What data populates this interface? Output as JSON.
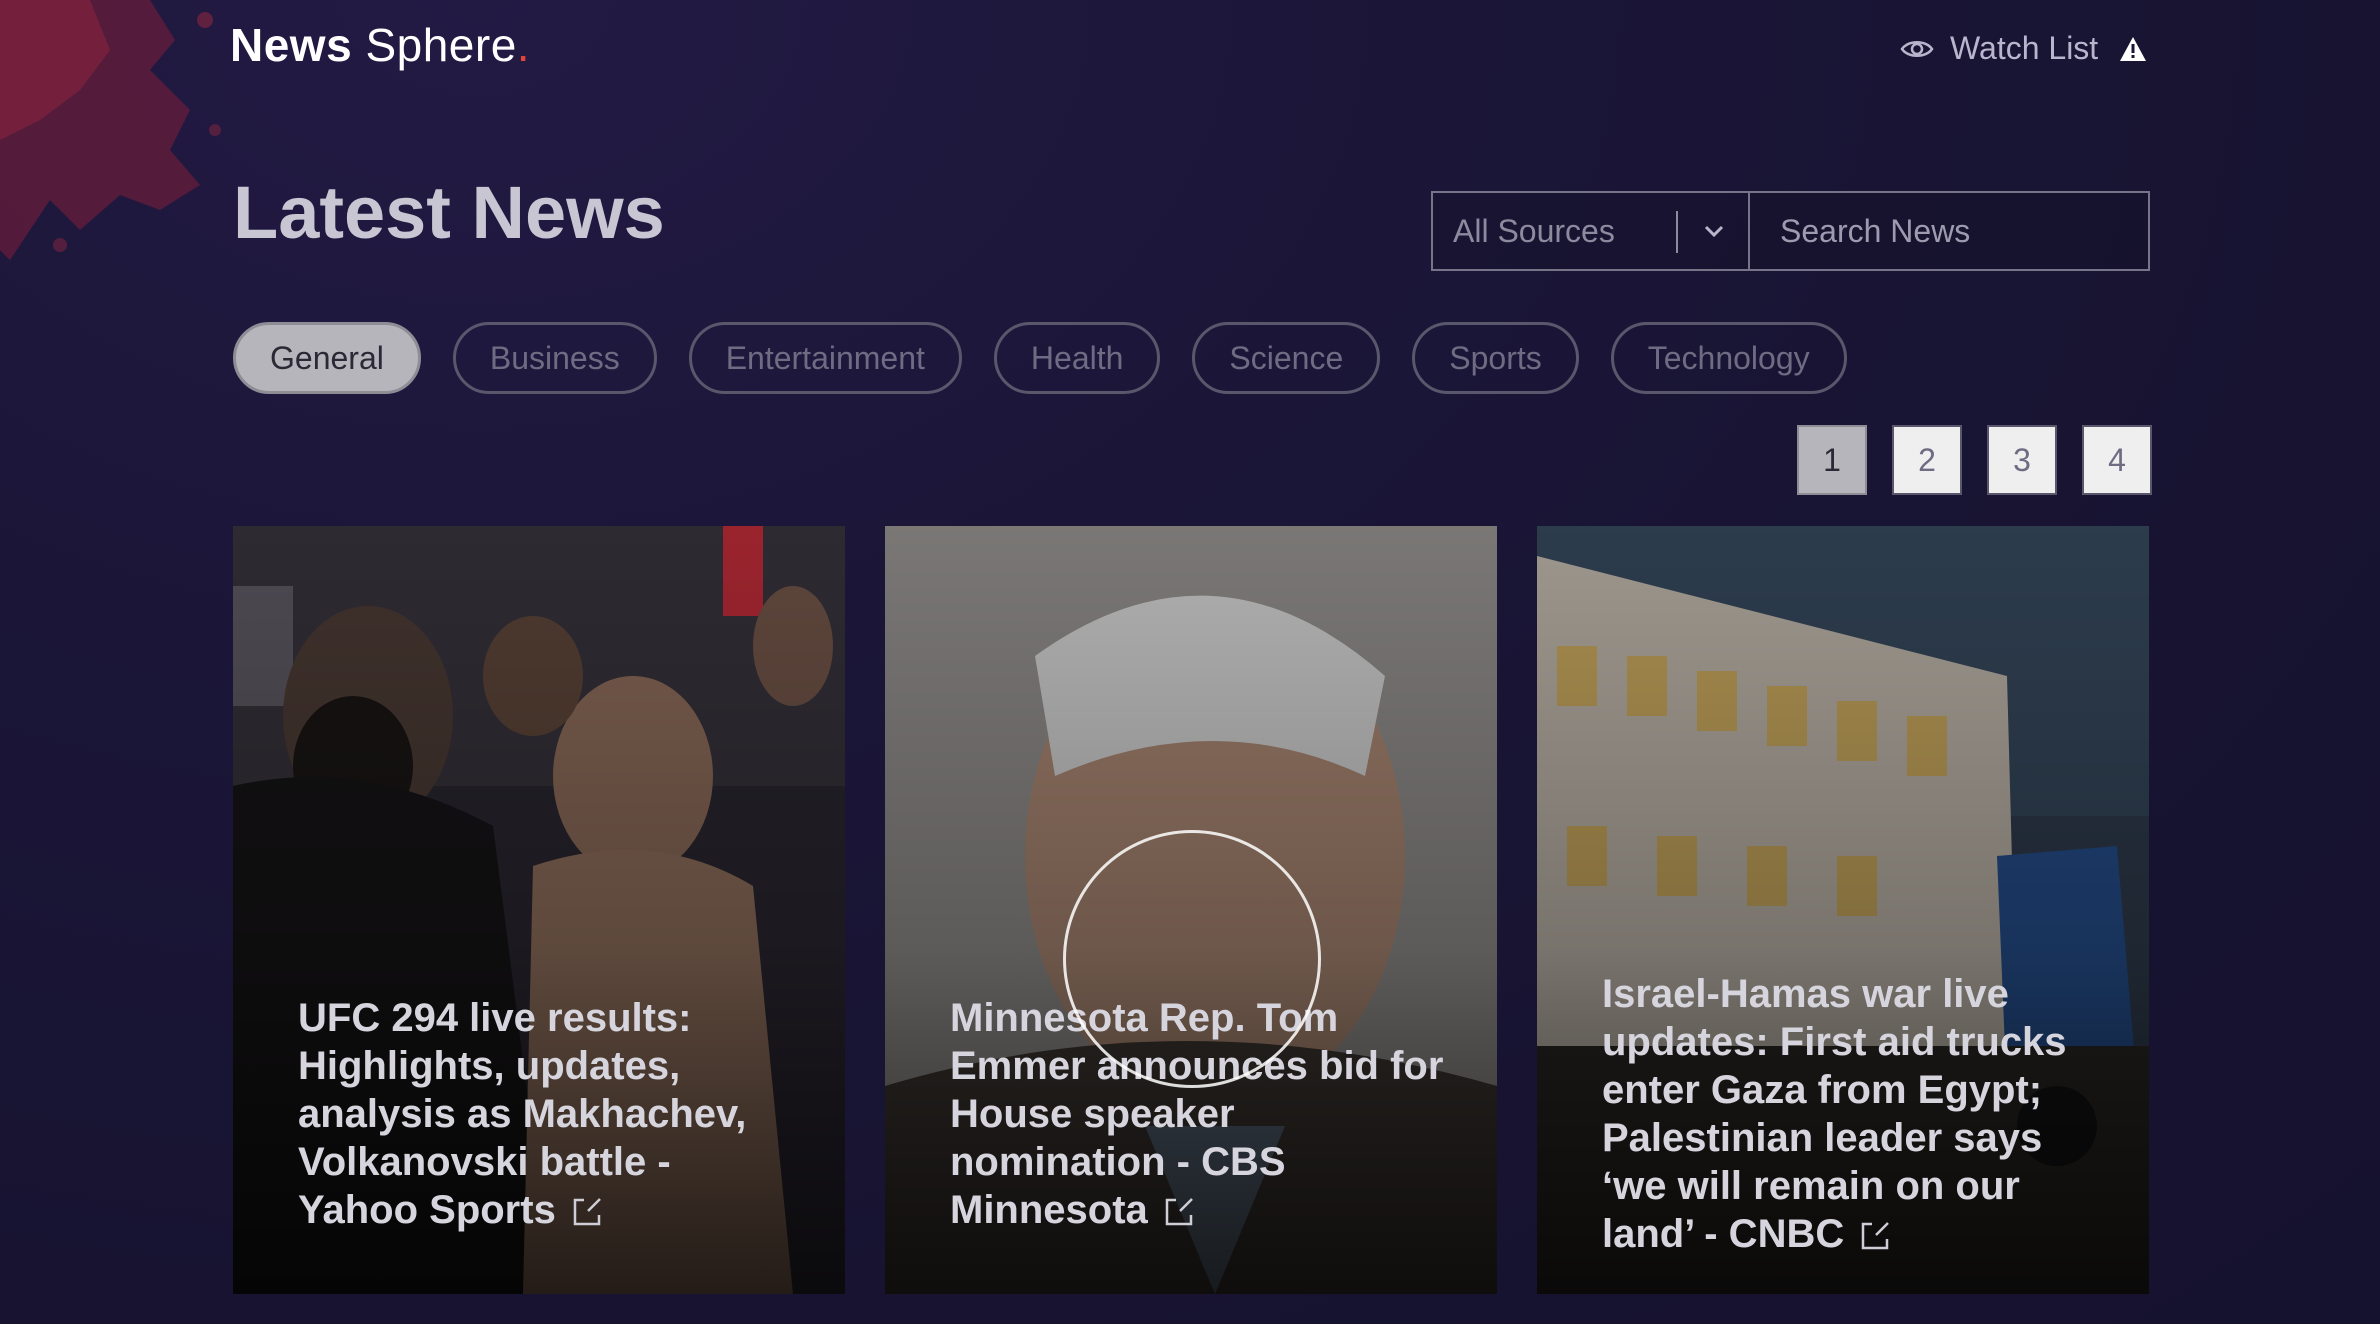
{
  "header": {
    "logo_bold": "News",
    "logo_light": "Sphere",
    "logo_dot": ".",
    "watch_list_label": "Watch List"
  },
  "main": {
    "title": "Latest News",
    "source_select": {
      "selected": "All Sources"
    },
    "search": {
      "placeholder": "Search News",
      "value": ""
    },
    "categories": [
      {
        "label": "General",
        "active": true
      },
      {
        "label": "Business",
        "active": false
      },
      {
        "label": "Entertainment",
        "active": false
      },
      {
        "label": "Health",
        "active": false
      },
      {
        "label": "Science",
        "active": false
      },
      {
        "label": "Sports",
        "active": false
      },
      {
        "label": "Technology",
        "active": false
      }
    ],
    "pagination": {
      "pages": [
        "1",
        "2",
        "3",
        "4"
      ],
      "current": "1"
    },
    "articles": [
      {
        "headline": "UFC 294 live results: Highlights, updates, analysis as Makhachev, Volkanovski battle - Yahoo Sports"
      },
      {
        "headline": "Minnesota Rep. Tom Emmer announces bid for House speaker nomination - CBS Minnesota"
      },
      {
        "headline": "Israel-Hamas war live updates: First aid trucks enter Gaza from Egypt; Palestinian leader says ‘we will remain on our land’ - CNBC"
      }
    ]
  },
  "icons": {
    "watch": "eye-icon",
    "warning": "warning-icon",
    "dropdown": "chevron-down-icon",
    "external": "external-link-icon"
  },
  "colors": {
    "background": "#1b1638",
    "accent_dot": "#e0453a",
    "chip_active": "#b6b5bb"
  }
}
